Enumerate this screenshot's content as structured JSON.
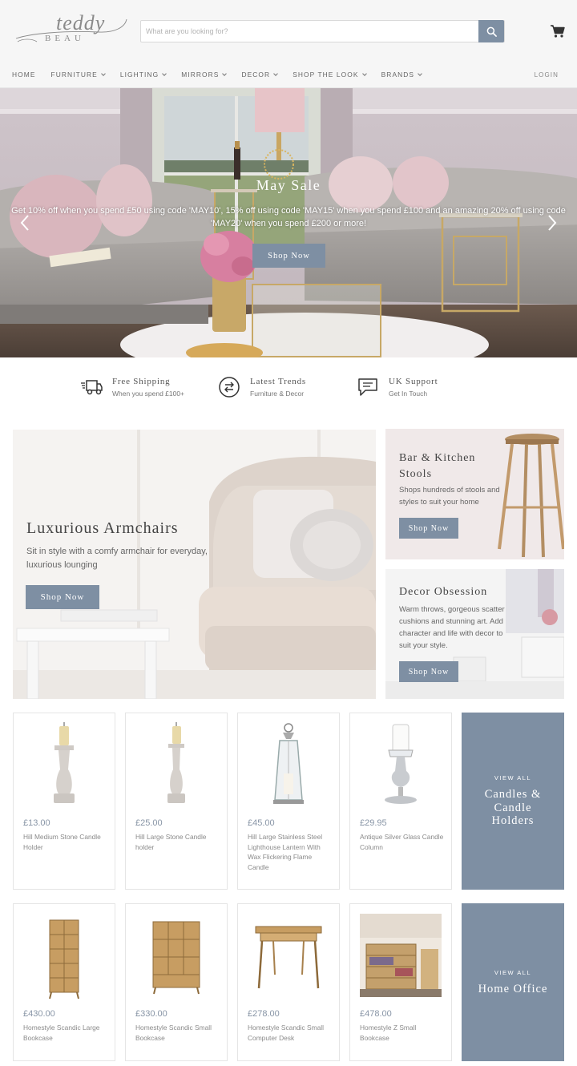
{
  "brand": {
    "name_script": "teddy",
    "name_caps": "BEAU"
  },
  "search": {
    "placeholder": "What are you looking for?"
  },
  "nav": {
    "items": [
      {
        "label": "HOME",
        "has_dropdown": false
      },
      {
        "label": "FURNITURE",
        "has_dropdown": true
      },
      {
        "label": "LIGHTING",
        "has_dropdown": true
      },
      {
        "label": "MIRRORS",
        "has_dropdown": true
      },
      {
        "label": "DECOR",
        "has_dropdown": true
      },
      {
        "label": "SHOP THE LOOK",
        "has_dropdown": true
      },
      {
        "label": "BRANDS",
        "has_dropdown": true
      }
    ],
    "login": "LOGIN"
  },
  "hero": {
    "title": "May Sale",
    "text": "Get 10% off when you spend £50 using code 'MAY10', 15% off using code 'MAY15' when you spend £100 and an amazing 20% off using code 'MAY20' when you spend £200 or more!",
    "button": "Shop Now"
  },
  "features": [
    {
      "icon": "delivery-truck-icon",
      "title": "Free Shipping",
      "sub": "When you spend £100+"
    },
    {
      "icon": "trend-arrows-icon",
      "title": "Latest Trends",
      "sub": "Furniture & Decor"
    },
    {
      "icon": "chat-bubble-icon",
      "title": "UK Support",
      "sub": "Get In Touch"
    }
  ],
  "promos": {
    "armchairs": {
      "title": "Luxurious Armchairs",
      "text": "Sit in style with a comfy armchair for everyday, luxurious lounging",
      "button": "Shop Now"
    },
    "stools": {
      "title": "Bar & Kitchen Stools",
      "text": "Shops hundreds of stools and styles to suit your home",
      "button": "Shop Now"
    },
    "decor": {
      "title": "Decor Obsession",
      "text": "Warm throws, gorgeous scatter cushions and stunning art. Add character and life with decor to suit your style.",
      "button": "Shop Now"
    }
  },
  "products_row1": [
    {
      "price": "£13.00",
      "name": "Hill Medium Stone Candle Holder"
    },
    {
      "price": "£25.00",
      "name": "Hill Large Stone Candle holder"
    },
    {
      "price": "£45.00",
      "name": "Hill Large Stainless Steel Lighthouse Lantern With Wax Flickering Flame Candle"
    },
    {
      "price": "£29.95",
      "name": "Antique Silver Glass Candle Column"
    }
  ],
  "viewall1": {
    "small": "VIEW ALL",
    "big": "Candles & Candle Holders"
  },
  "products_row2": [
    {
      "price": "£430.00",
      "name": "Homestyle Scandic Large Bookcase"
    },
    {
      "price": "£330.00",
      "name": "Homestyle Scandic Small Bookcase"
    },
    {
      "price": "£278.00",
      "name": "Homestyle Scandic Small Computer Desk"
    },
    {
      "price": "£478.00",
      "name": "Homestyle Z Small Bookcase"
    }
  ],
  "viewall2": {
    "small": "VIEW ALL",
    "big": "Home Office"
  },
  "colors": {
    "accent": "#7e8fa3",
    "header_bg": "#f6f6f6",
    "price": "#8895a6"
  }
}
